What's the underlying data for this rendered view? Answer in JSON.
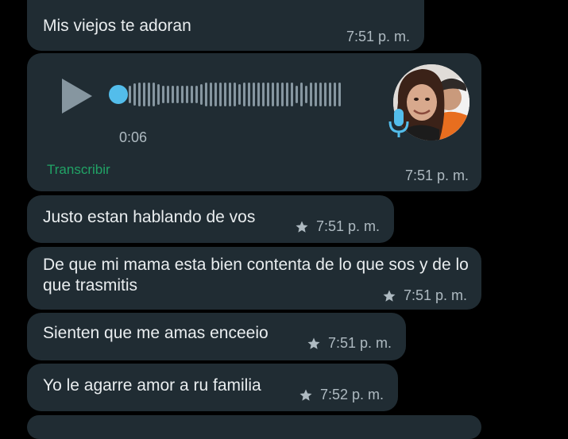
{
  "messages": [
    {
      "text": "Mis viejos te adoran",
      "time": "7:51 p. m.",
      "starred": false
    },
    {
      "type": "voice",
      "duration": "0:06",
      "transcribe_label": "Transcribir",
      "time": "7:51 p. m."
    },
    {
      "text": "Justo estan hablando de vos",
      "time": "7:51 p. m.",
      "starred": true
    },
    {
      "text": "De que mi mama esta bien contenta de lo que sos y de lo que trasmitis",
      "time": "7:51 p. m.",
      "starred": true
    },
    {
      "text": "Sienten que me amas enceeio",
      "time": "7:51 p. m.",
      "starred": true
    },
    {
      "text": "Yo le agarre amor a ru familia",
      "time": "7:52 p. m.",
      "starred": true
    }
  ],
  "colors": {
    "background": "#000000",
    "bubble": "#202c33",
    "text": "#e9edef",
    "meta": "#aebac1",
    "accent_blue": "#53bdeb",
    "transcribe_green": "#21a366"
  },
  "icons": {
    "play": "play-icon",
    "mic": "microphone-icon",
    "star": "star-icon"
  }
}
